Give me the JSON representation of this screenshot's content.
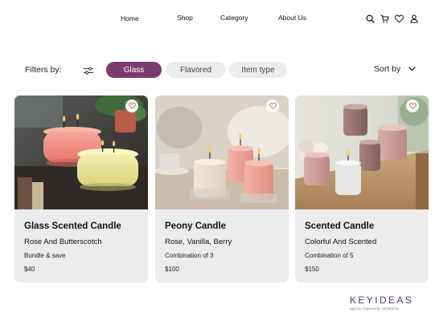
{
  "nav": {
    "links": [
      "Home",
      "Shop",
      "Category",
      "About Us"
    ],
    "icons": [
      "search-icon",
      "cart-icon",
      "heart-icon",
      "user-icon"
    ]
  },
  "filters": {
    "label": "Filters by:",
    "chips": [
      "Glass",
      "Flavored",
      "Item type"
    ],
    "active": "Glass",
    "sort_label": "Sort by"
  },
  "products": [
    {
      "title": "Glass Scented Candle",
      "subtitle": "Rose And Butterscotch",
      "note": "Bundle & save",
      "price": "$40"
    },
    {
      "title": "Peony Candle",
      "subtitle": "Rose, Vanilla, Berry",
      "note": "Combination of 3",
      "price": "$100"
    },
    {
      "title": "Scented Candle",
      "subtitle": "Colorful And Scented",
      "note": "Combination of 5",
      "price": "$150"
    }
  ],
  "brand": {
    "name": "KEYIDEAS",
    "tagline": "agility·ingenuity·reliability"
  },
  "colors": {
    "accent": "#7a3b6e",
    "chip_bg": "#ececec",
    "card_bg": "#ececec"
  }
}
